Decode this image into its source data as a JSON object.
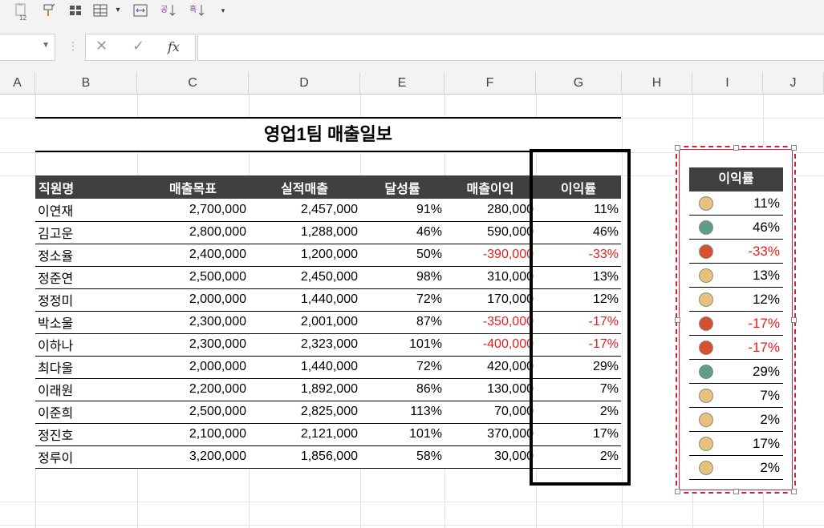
{
  "toolbar": {
    "icons": [
      "paste-values-icon",
      "format-painter-icon",
      "grid-icon",
      "merge-icon",
      "dropdown-icon",
      "fit-column-icon",
      "sort-ascending-icon",
      "sort-descending-icon",
      "more-icon"
    ],
    "paste_badge": "12"
  },
  "formula_bar": {
    "name_box": "",
    "cancel_symbol": "✕",
    "enter_symbol": "✓",
    "fx_label": "fx",
    "content": ""
  },
  "columns": [
    "A",
    "B",
    "C",
    "D",
    "E",
    "F",
    "G",
    "H",
    "I",
    "J"
  ],
  "sheet": {
    "title": "영업1팀 매출일보",
    "headers": [
      "직원명",
      "매출목표",
      "실적매출",
      "달성률",
      "매출이익",
      "이익률"
    ],
    "rows": [
      {
        "name": "이연재",
        "target": "2,700,000",
        "actual": "2,457,000",
        "rate": "91%",
        "profit": "280,000",
        "margin": "11%",
        "neg": false
      },
      {
        "name": "김고운",
        "target": "2,800,000",
        "actual": "1,288,000",
        "rate": "46%",
        "profit": "590,000",
        "margin": "46%",
        "neg": false
      },
      {
        "name": "정소율",
        "target": "2,400,000",
        "actual": "1,200,000",
        "rate": "50%",
        "profit": "-390,000",
        "margin": "-33%",
        "neg": true
      },
      {
        "name": "정준연",
        "target": "2,500,000",
        "actual": "2,450,000",
        "rate": "98%",
        "profit": "310,000",
        "margin": "13%",
        "neg": false
      },
      {
        "name": "정정미",
        "target": "2,000,000",
        "actual": "1,440,000",
        "rate": "72%",
        "profit": "170,000",
        "margin": "12%",
        "neg": false
      },
      {
        "name": "박소울",
        "target": "2,300,000",
        "actual": "2,001,000",
        "rate": "87%",
        "profit": "-350,000",
        "margin": "-17%",
        "neg": true
      },
      {
        "name": "이하나",
        "target": "2,300,000",
        "actual": "2,323,000",
        "rate": "101%",
        "profit": "-400,000",
        "margin": "-17%",
        "neg": true
      },
      {
        "name": "최다울",
        "target": "2,000,000",
        "actual": "1,440,000",
        "rate": "72%",
        "profit": "420,000",
        "margin": "29%",
        "neg": false
      },
      {
        "name": "이래원",
        "target": "2,200,000",
        "actual": "1,892,000",
        "rate": "86%",
        "profit": "130,000",
        "margin": "7%",
        "neg": false
      },
      {
        "name": "이준희",
        "target": "2,500,000",
        "actual": "2,825,000",
        "rate": "113%",
        "profit": "70,000",
        "margin": "2%",
        "neg": false
      },
      {
        "name": "정진호",
        "target": "2,100,000",
        "actual": "2,121,000",
        "rate": "101%",
        "profit": "370,000",
        "margin": "17%",
        "neg": false
      },
      {
        "name": "정루이",
        "target": "3,200,000",
        "actual": "1,856,000",
        "rate": "58%",
        "profit": "30,000",
        "margin": "2%",
        "neg": false
      }
    ]
  },
  "linked_picture": {
    "header": "이익률",
    "rows": [
      {
        "margin": "11%",
        "status": "yellow",
        "neg": false
      },
      {
        "margin": "46%",
        "status": "green",
        "neg": false
      },
      {
        "margin": "-33%",
        "status": "red",
        "neg": true
      },
      {
        "margin": "13%",
        "status": "yellow",
        "neg": false
      },
      {
        "margin": "12%",
        "status": "yellow",
        "neg": false
      },
      {
        "margin": "-17%",
        "status": "red",
        "neg": true
      },
      {
        "margin": "-17%",
        "status": "red",
        "neg": true
      },
      {
        "margin": "29%",
        "status": "green",
        "neg": false
      },
      {
        "margin": "7%",
        "status": "yellow",
        "neg": false
      },
      {
        "margin": "2%",
        "status": "yellow",
        "neg": false
      },
      {
        "margin": "17%",
        "status": "yellow",
        "neg": false
      },
      {
        "margin": "2%",
        "status": "yellow",
        "neg": false
      }
    ],
    "status_colors": {
      "yellow": "#e8c27a",
      "green": "#5f9e86",
      "red": "#d5502f"
    }
  },
  "colors": {
    "header_bg": "#404040",
    "negative": "#e51c1c",
    "selection": "#d0213a"
  }
}
